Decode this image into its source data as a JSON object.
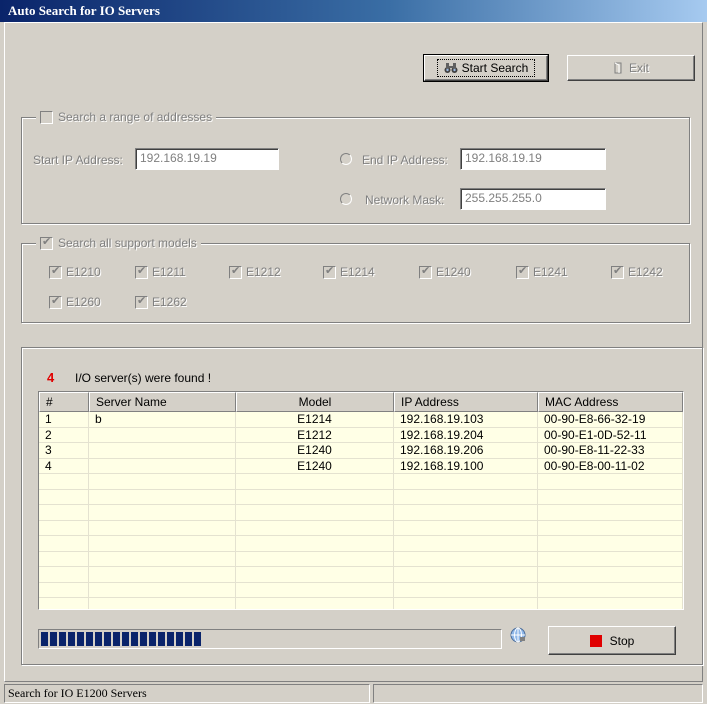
{
  "window": {
    "title": "Auto Search for IO Servers"
  },
  "toolbar": {
    "start_search_label": "Start Search",
    "exit_label": "Exit"
  },
  "range_group": {
    "label": "Search a range of addresses",
    "checked": false,
    "start_ip_label": "Start IP Address:",
    "start_ip_value": "192.168.19.19",
    "end_ip_label": "End IP Address:",
    "end_ip_value": "192.168.19.19",
    "mask_label": "Network Mask:",
    "mask_value": "255.255.255.0"
  },
  "models_group": {
    "label": "Search all support models",
    "checked": true,
    "models": [
      {
        "label": "E1210",
        "checked": true
      },
      {
        "label": "E1211",
        "checked": true
      },
      {
        "label": "E1212",
        "checked": true
      },
      {
        "label": "E1214",
        "checked": true
      },
      {
        "label": "E1240",
        "checked": true
      },
      {
        "label": "E1241",
        "checked": true
      },
      {
        "label": "E1242",
        "checked": true
      },
      {
        "label": "E1260",
        "checked": true
      },
      {
        "label": "E1262",
        "checked": true
      }
    ]
  },
  "results": {
    "count": "4",
    "found_text": "I/O server(s) were found !",
    "columns": [
      "#",
      "Server Name",
      "Model",
      "IP Address",
      "MAC Address"
    ],
    "rows": [
      {
        "num": "1",
        "name": "b",
        "model": "E1214",
        "ip": "192.168.19.103",
        "mac": "00-90-E8-66-32-19"
      },
      {
        "num": "2",
        "name": "",
        "model": "E1212",
        "ip": "192.168.19.204",
        "mac": "00-90-E1-0D-52-11"
      },
      {
        "num": "3",
        "name": "",
        "model": "E1240",
        "ip": "192.168.19.206",
        "mac": "00-90-E8-11-22-33"
      },
      {
        "num": "4",
        "name": "",
        "model": "E1240",
        "ip": "192.168.19.100",
        "mac": "00-90-E8-00-11-02"
      }
    ]
  },
  "progress": {
    "fraction": 0.35
  },
  "stop_label": "Stop",
  "status": {
    "text": "Search for IO E1200 Servers",
    "pane2": ""
  },
  "colors": {
    "title_start": "#0a246a",
    "title_end": "#a6caf0",
    "progress": "#0a246a",
    "stop_icon": "#e00000",
    "found_count": "#e00000",
    "list_bg": "#ffffe6"
  }
}
